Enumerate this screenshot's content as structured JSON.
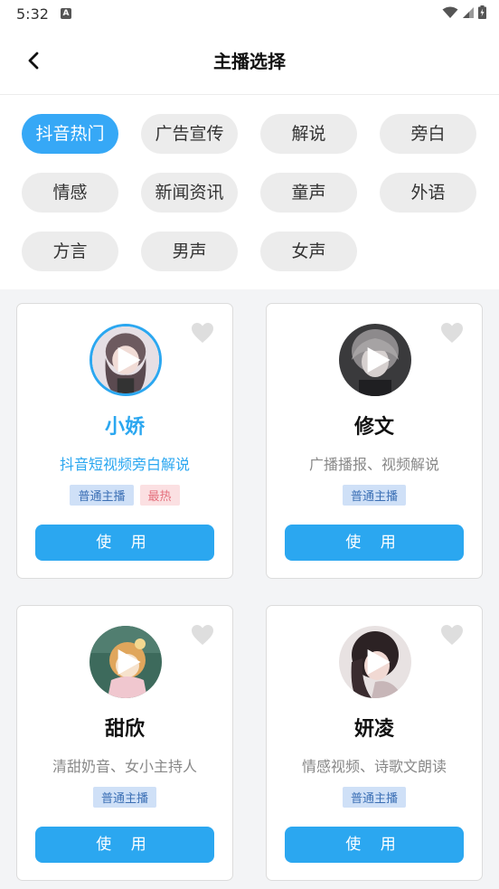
{
  "status_bar": {
    "time": "5:32",
    "a_badge": "A"
  },
  "header": {
    "title": "主播选择"
  },
  "categories": [
    {
      "label": "抖音热门",
      "active": true
    },
    {
      "label": "广告宣传"
    },
    {
      "label": "解说"
    },
    {
      "label": "旁白"
    },
    {
      "label": "情感"
    },
    {
      "label": "新闻资讯"
    },
    {
      "label": "童声"
    },
    {
      "label": "外语"
    },
    {
      "label": "方言"
    },
    {
      "label": "男声"
    },
    {
      "label": "女声"
    }
  ],
  "anchors": [
    {
      "name": "小娇",
      "desc": "抖音短视频旁白解说",
      "tags": [
        "普通主播",
        "最热"
      ],
      "button": "使 用",
      "selected": true
    },
    {
      "name": "修文",
      "desc": "广播播报、视频解说",
      "tags": [
        "普通主播"
      ],
      "button": "使 用"
    },
    {
      "name": "甜欣",
      "desc": "清甜奶音、女小主持人",
      "tags": [
        "普通主播"
      ],
      "button": "使 用"
    },
    {
      "name": "妍凌",
      "desc": "情感视频、诗歌文朗读",
      "tags": [
        "普通主播"
      ],
      "button": "使 用"
    }
  ],
  "icons": {
    "back": "chevron-left-icon",
    "favorite": "heart-icon",
    "play": "play-icon",
    "wifi": "wifi-icon",
    "signal": "signal-icon",
    "battery": "battery-icon"
  },
  "colors": {
    "accent": "#2ba7f0",
    "hot_tag": "#e4707d",
    "tag_bg": "#cfe0f7"
  }
}
